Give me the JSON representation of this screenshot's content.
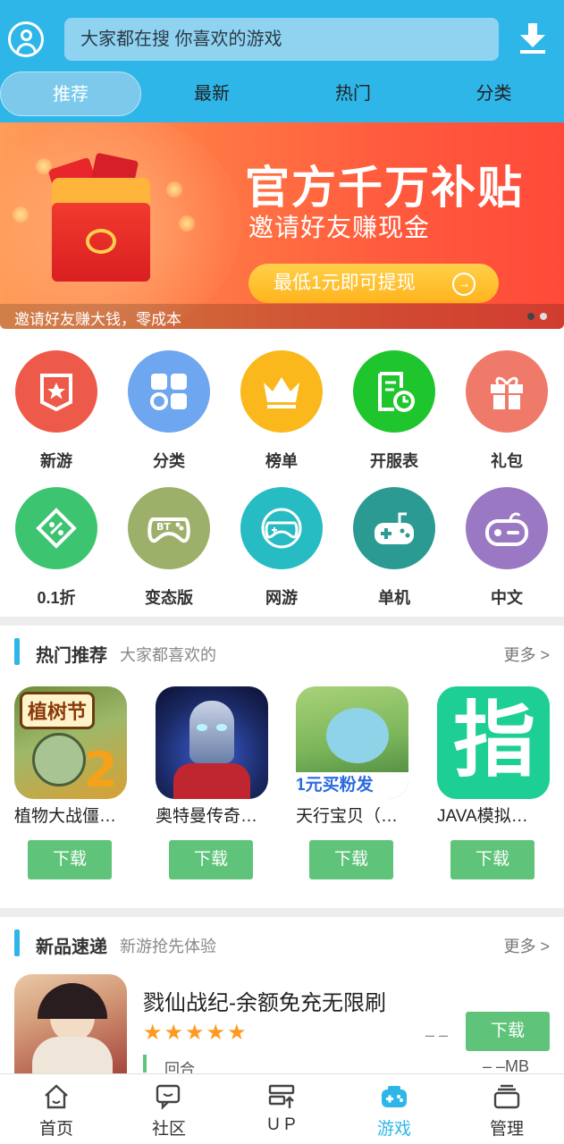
{
  "header": {
    "search_placeholder": "大家都在搜  你喜欢的游戏",
    "tabs": [
      {
        "label": "推荐",
        "active": true
      },
      {
        "label": "最新",
        "active": false
      },
      {
        "label": "热门",
        "active": false
      },
      {
        "label": "分类",
        "active": false
      }
    ]
  },
  "banner": {
    "headline": "官方千万补贴",
    "subline": "邀请好友赚现金",
    "cta": "最低1元即可提现",
    "caption": "邀请好友赚大钱，零成本",
    "slide_count": 2
  },
  "categories": [
    {
      "label": "新游",
      "icon": "shield-star-icon",
      "color": "#ee5a4a"
    },
    {
      "label": "分类",
      "icon": "grid-icon",
      "color": "#6fa6f0"
    },
    {
      "label": "榜单",
      "icon": "crown-icon",
      "color": "#fbb81c"
    },
    {
      "label": "开服表",
      "icon": "schedule-icon",
      "color": "#1ec52d"
    },
    {
      "label": "礼包",
      "icon": "gift-icon",
      "color": "#f07a6a"
    },
    {
      "label": "0.1折",
      "icon": "discount-tag-icon",
      "color": "#3cc470"
    },
    {
      "label": "变态版",
      "icon": "bt-gamepad-icon",
      "color": "#9cb06a"
    },
    {
      "label": "网游",
      "icon": "online-gamepad-icon",
      "color": "#27bcc3"
    },
    {
      "label": "单机",
      "icon": "joystick-icon",
      "color": "#2b9a93"
    },
    {
      "label": "中文",
      "icon": "controller-icon",
      "color": "#9a78c4"
    }
  ],
  "hot": {
    "title": "热门推荐",
    "subtitle": "大家都喜欢的",
    "more": "更多 >",
    "games": [
      {
        "name": "植物大战僵…",
        "icon_text": "植树节",
        "download": "下载"
      },
      {
        "name": "奥特曼传奇…",
        "icon_text": "",
        "download": "下载"
      },
      {
        "name": "天行宝贝（…",
        "icon_text": "1元买粉发",
        "download": "下载"
      },
      {
        "name": "JAVA模拟…",
        "icon_text": "指",
        "download": "下载"
      }
    ]
  },
  "new": {
    "title": "新品速递",
    "subtitle": "新游抢先体验",
    "more": "更多 >",
    "item": {
      "name": "戮仙战纪-余额免充无限刷",
      "stars": "★★★★★",
      "rating": "– –",
      "download": "下载",
      "tag": "回合",
      "size": "– –MB"
    }
  },
  "bottom_nav": [
    {
      "label": "首页",
      "icon": "home-icon",
      "active": false
    },
    {
      "label": "社区",
      "icon": "community-icon",
      "active": false
    },
    {
      "label": "U P",
      "icon": "up-icon",
      "active": false
    },
    {
      "label": "游戏",
      "icon": "gamepad-icon",
      "active": true
    },
    {
      "label": "管理",
      "icon": "manage-icon",
      "active": false
    }
  ],
  "colors": {
    "primary": "#2fb6e9",
    "download_green": "#5fc47a",
    "star_orange": "#ff9a1f"
  }
}
